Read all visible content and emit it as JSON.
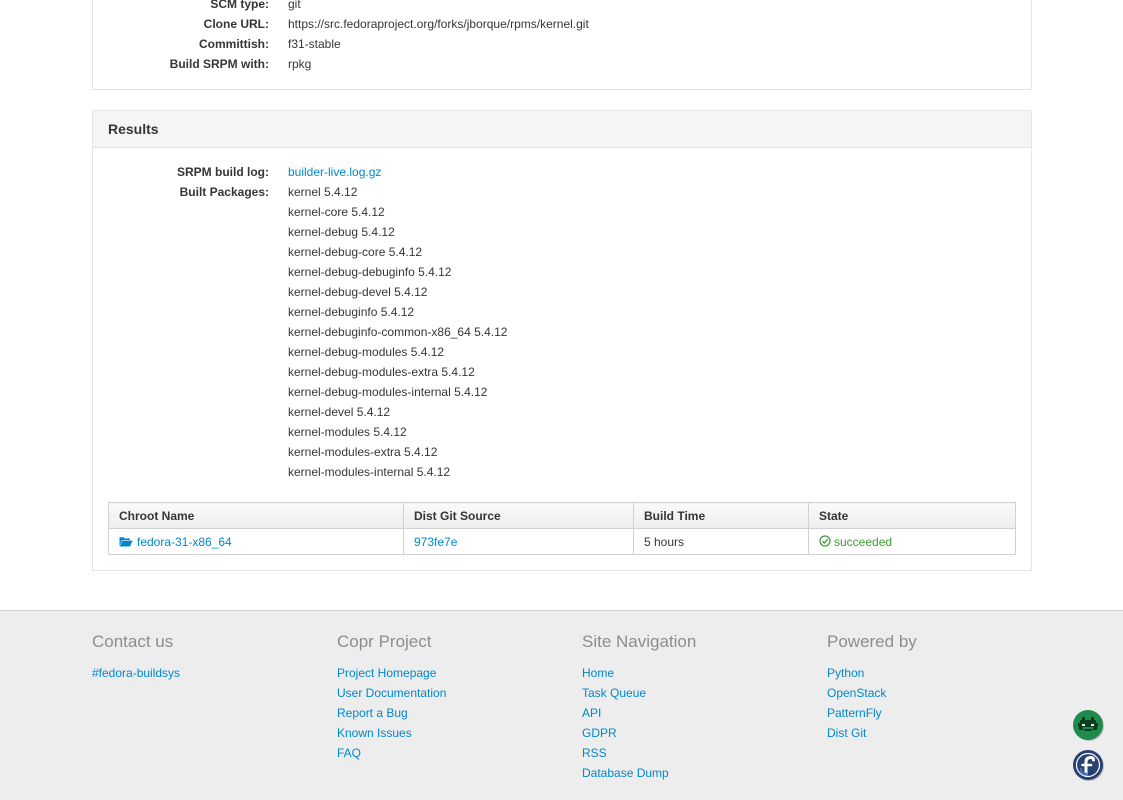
{
  "source": {
    "scm_type_label": "SCM type:",
    "scm_type": "git",
    "clone_url_label": "Clone URL:",
    "clone_url": "https://src.fedoraproject.org/forks/jborque/rpms/kernel.git",
    "committish_label": "Committish:",
    "committish": "f31-stable",
    "build_srpm_label": "Build SRPM with:",
    "build_srpm": "rpkg"
  },
  "results": {
    "title": "Results",
    "srpm_log_label": "SRPM build log:",
    "srpm_log_link": "builder-live.log.gz",
    "built_packages_label": "Built Packages:",
    "packages": [
      "kernel 5.4.12",
      "kernel-core 5.4.12",
      "kernel-debug 5.4.12",
      "kernel-debug-core 5.4.12",
      "kernel-debug-debuginfo 5.4.12",
      "kernel-debug-devel 5.4.12",
      "kernel-debuginfo 5.4.12",
      "kernel-debuginfo-common-x86_64 5.4.12",
      "kernel-debug-modules 5.4.12",
      "kernel-debug-modules-extra 5.4.12",
      "kernel-debug-modules-internal 5.4.12",
      "kernel-devel 5.4.12",
      "kernel-modules 5.4.12",
      "kernel-modules-extra 5.4.12",
      "kernel-modules-internal 5.4.12"
    ]
  },
  "chroot_table": {
    "headers": [
      "Chroot Name",
      "Dist Git Source",
      "Build Time",
      "State"
    ],
    "rows": [
      {
        "chroot": "fedora-31-x86_64",
        "dist_git": "973fe7e",
        "build_time": "5 hours",
        "state": "succeeded"
      }
    ]
  },
  "footer": {
    "contact": {
      "title": "Contact us",
      "links": [
        "#fedora-buildsys"
      ]
    },
    "project": {
      "title": "Copr Project",
      "links": [
        "Project Homepage",
        "User Documentation",
        "Report a Bug",
        "Known Issues",
        "FAQ"
      ]
    },
    "navigation": {
      "title": "Site Navigation",
      "links": [
        "Home",
        "Task Queue",
        "API",
        "GDPR",
        "RSS",
        "Database Dump"
      ]
    },
    "powered": {
      "title": "Powered by",
      "links": [
        "Python",
        "OpenStack",
        "PatternFly",
        "Dist Git"
      ]
    }
  },
  "icons": {
    "folder": "folder-open-icon",
    "state_ok": "check-circle-icon",
    "badge_top": "space-invader-badge-icon",
    "badge_bottom": "fedora-logo-badge-icon"
  },
  "colors": {
    "link": "#0088ce",
    "success": "#3f9c35",
    "footer_bg": "#ededed"
  }
}
